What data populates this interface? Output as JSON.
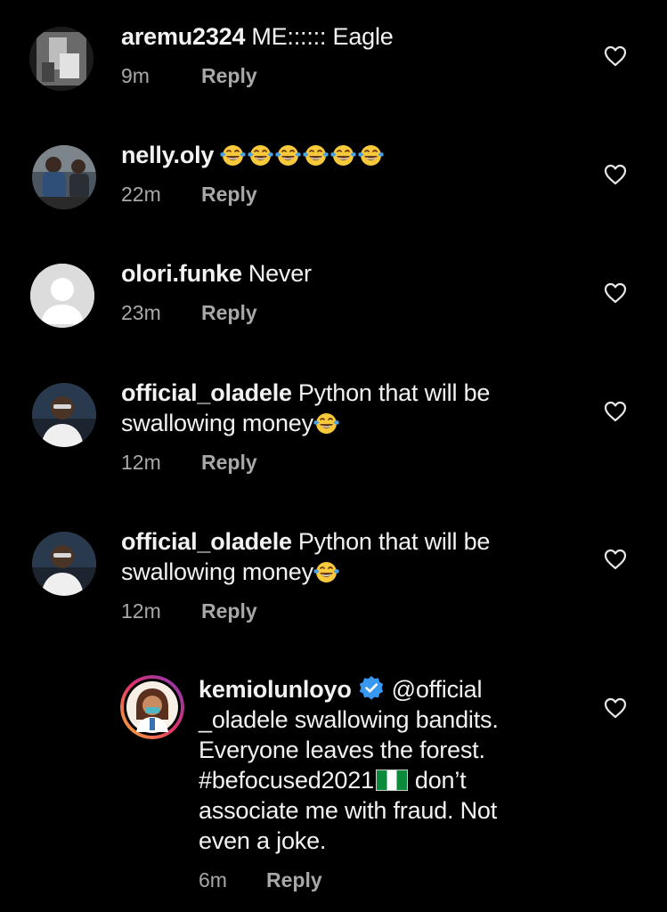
{
  "comments": [
    {
      "username": "aremu2324",
      "text": "ME:::::: Eagle",
      "time": "9m",
      "reply": "Reply",
      "emoji_count": 0,
      "avatar_icon": "photo-avatar-gray"
    },
    {
      "username": "nelly.oly",
      "text": "",
      "time": "22m",
      "reply": "Reply",
      "emoji_count": 6,
      "emoji_icon": "face-with-tears-of-joy",
      "avatar_icon": "photo-avatar-people"
    },
    {
      "username": "olori.funke",
      "text": "Never",
      "time": "23m",
      "reply": "Reply",
      "emoji_count": 0,
      "avatar_icon": "default-avatar"
    },
    {
      "username": "official_oladele",
      "text": "Python that will be swallowing money",
      "time": "12m",
      "reply": "Reply",
      "emoji_count": 1,
      "emoji_icon": "face-with-tears-of-joy",
      "avatar_icon": "photo-avatar-person"
    },
    {
      "username": "official_oladele",
      "text": "Python that will be swallowing money",
      "time": "12m",
      "reply": "Reply",
      "emoji_count": 1,
      "emoji_icon": "face-with-tears-of-joy",
      "avatar_icon": "photo-avatar-person"
    }
  ],
  "reply_comment": {
    "username": "kemiolunloyo",
    "verified_icon": "verified-badge-icon",
    "text_part1": "@official _oladele swallowing bandits. Everyone leaves the forest. #befocused2021",
    "flag_icon": "nigeria-flag",
    "text_part2": "don’t associate me with fraud. Not even a joke.",
    "time": "6m",
    "reply": "Reply",
    "avatar_icon": "illustrated-avatar-story-ring"
  },
  "colors": {
    "background": "#000000",
    "text": "#f2f2f2",
    "muted": "#a8a8a8",
    "verified": "#3897f0"
  },
  "like_icon": "heart-outline-icon"
}
